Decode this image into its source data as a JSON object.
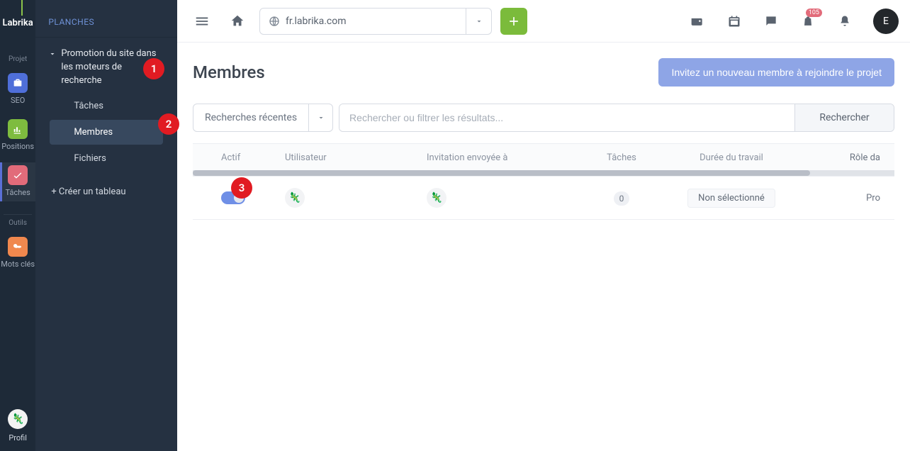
{
  "brand": "Labrika",
  "nav_rail": {
    "sections": [
      {
        "label": "Projet"
      },
      {
        "label": "Outils"
      }
    ],
    "items": {
      "seo": "SEO",
      "positions": "Positions",
      "tasks": "Tâches",
      "keywords": "Mots clés",
      "profile": "Profil"
    },
    "colors": {
      "seo": "#4f6fd9",
      "positions": "#7ebc3f",
      "tasks": "#e26b7a",
      "keywords": "#f0884e"
    }
  },
  "side_panel": {
    "heading": "PLANCHES",
    "board_group_title": "Promotion du site dans les moteurs de recherche",
    "items": {
      "tasks": "Tâches",
      "members": "Membres",
      "files": "Fichiers"
    },
    "create": "+ Créer un tableau"
  },
  "topbar": {
    "url": "fr.labrika.com",
    "badge_count": "105",
    "user_initial": "E"
  },
  "page": {
    "title": "Membres",
    "invite_label": "Invitez un nouveau membre à rejoindre le projet"
  },
  "filters": {
    "recent_label": "Recherches récentes",
    "search_placeholder": "Rechercher ou filtrer les résultats...",
    "search_button": "Rechercher"
  },
  "table": {
    "columns": {
      "active": "Actif",
      "user": "Utilisateur",
      "invitation": "Invitation envoyée à",
      "tasks": "Tâches",
      "work_duration": "Durée du travail",
      "role": "Rôle da"
    },
    "rows": [
      {
        "active": true,
        "tasks": "0",
        "work_duration": "Non sélectionné",
        "role": "Pro"
      }
    ]
  },
  "annotations": [
    "1",
    "2",
    "3"
  ]
}
